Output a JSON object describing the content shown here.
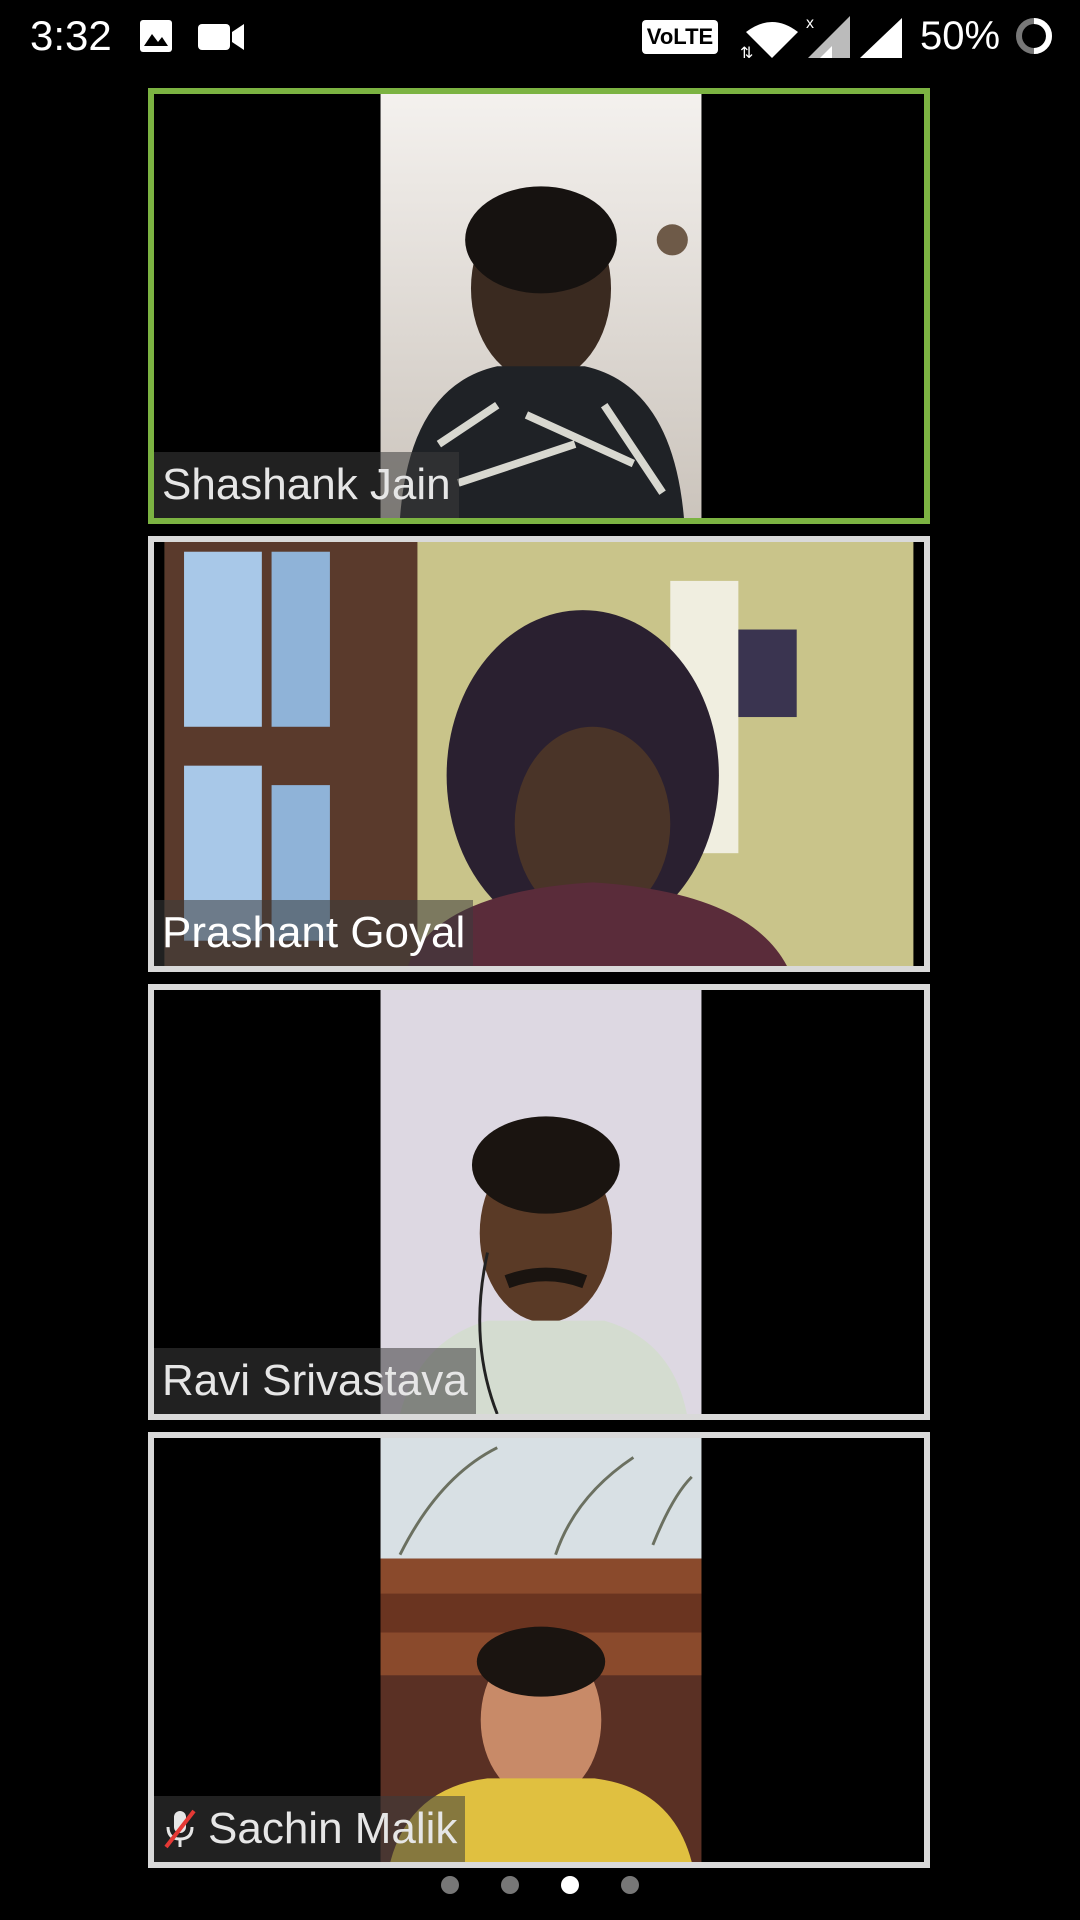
{
  "status_bar": {
    "time": "3:32",
    "volte_label": "VoLTE",
    "battery_percent": "50%",
    "icons": [
      "image-icon",
      "video-camera-icon",
      "volte-icon",
      "wifi-icon",
      "signal-x-icon",
      "signal-icon",
      "battery-ring-icon"
    ]
  },
  "participants": [
    {
      "name": "Shashank Jain",
      "active_speaker": true,
      "muted": false
    },
    {
      "name": "Prashant Goyal",
      "active_speaker": false,
      "muted": false
    },
    {
      "name": "Ravi Srivastava",
      "active_speaker": false,
      "muted": false
    },
    {
      "name": "Sachin Malik",
      "active_speaker": false,
      "muted": true
    }
  ],
  "pagination": {
    "total_pages": 4,
    "current_page": 3
  },
  "colors": {
    "active_border": "#7cb342",
    "tile_border": "#d9d9d9",
    "background": "#000000"
  }
}
